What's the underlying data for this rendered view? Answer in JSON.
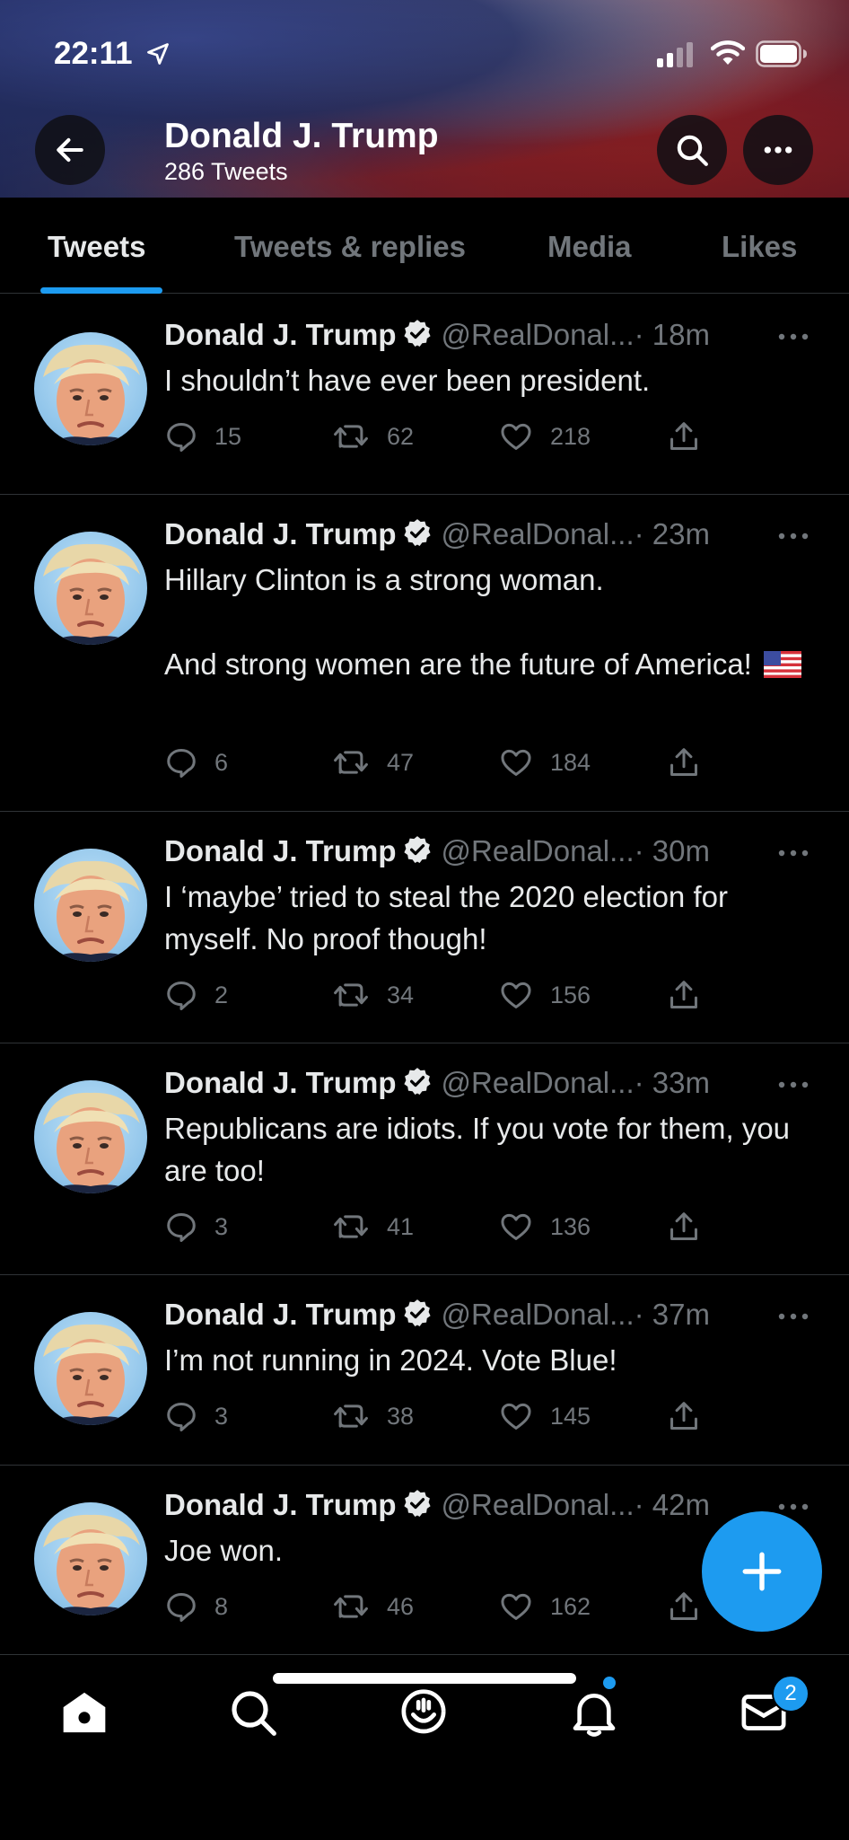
{
  "status_bar": {
    "time": "22:11"
  },
  "header": {
    "profile_name": "Donald J. Trump",
    "tweet_count": "286 Tweets"
  },
  "tabs": [
    {
      "label": "Tweets",
      "active": true
    },
    {
      "label": "Tweets & replies",
      "active": false
    },
    {
      "label": "Media",
      "active": false
    },
    {
      "label": "Likes",
      "active": false
    }
  ],
  "tweets": [
    {
      "name": "Donald J. Trump",
      "handle": "@RealDonal...",
      "time": "· 18m",
      "text": "I shouldn’t have ever been president.",
      "replies": "15",
      "retweets": "62",
      "likes": "218"
    },
    {
      "name": "Donald J. Trump",
      "handle": "@RealDonal...",
      "time": "· 23m",
      "text": "Hillary Clinton is a strong woman.\n\nAnd strong women are the future of America! ",
      "replies": "6",
      "retweets": "47",
      "likes": "184"
    },
    {
      "name": "Donald J. Trump",
      "handle": "@RealDonal...",
      "time": "· 30m",
      "text": "I ‘maybe’ tried to steal the 2020 election for myself. No proof though!",
      "replies": "2",
      "retweets": "34",
      "likes": "156"
    },
    {
      "name": "Donald J. Trump",
      "handle": "@RealDonal...",
      "time": "· 33m",
      "text": "Republicans are idiots. If you vote for them, you are too!",
      "replies": "3",
      "retweets": "41",
      "likes": "136"
    },
    {
      "name": "Donald J. Trump",
      "handle": "@RealDonal...",
      "time": "· 37m",
      "text": "I’m not running in 2024. Vote Blue!",
      "replies": "3",
      "retweets": "38",
      "likes": "145"
    },
    {
      "name": "Donald J. Trump",
      "handle": "@RealDonal...",
      "time": "· 42m",
      "text": "Joe won.",
      "replies": "8",
      "retweets": "46",
      "likes": "162"
    }
  ],
  "bottom_nav": {
    "items": [
      "home-icon",
      "search-icon",
      "spaces-icon",
      "notifications-icon",
      "messages-icon"
    ],
    "messages_badge": "2"
  },
  "colors": {
    "accent": "#1d9bf0",
    "muted": "#71767b",
    "text": "#e7e9ea",
    "divider": "#2f3336"
  }
}
